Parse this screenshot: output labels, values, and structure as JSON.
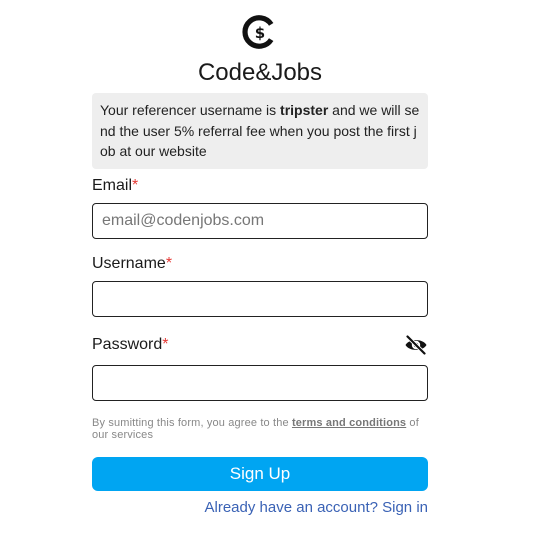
{
  "brand": {
    "title": "Code&Jobs",
    "logo_icon": "dollar-coin-c-icon"
  },
  "notice": {
    "prefix": "Your referencer username is ",
    "username": "tripster",
    "suffix": " and we will send the user 5% referral fee when you post the first job at our website"
  },
  "form": {
    "email": {
      "label": "Email",
      "required_mark": "*",
      "placeholder": "email@codenjobs.com",
      "value": ""
    },
    "username": {
      "label": "Username",
      "required_mark": "*",
      "value": ""
    },
    "password": {
      "label": "Password",
      "required_mark": "*",
      "value": "",
      "toggle_icon": "eye-off-icon"
    },
    "terms": {
      "prefix": "By sumitting this form, you agree to the ",
      "link": "terms and conditions",
      "suffix": " of our services"
    },
    "submit_label": "Sign Up",
    "signin_prompt": "Already have an account?",
    "signin_link": "Sign in"
  },
  "colors": {
    "accent": "#00a5f2",
    "link": "#3a62b5",
    "required": "#e53935",
    "notice_bg": "#eeeeee"
  }
}
